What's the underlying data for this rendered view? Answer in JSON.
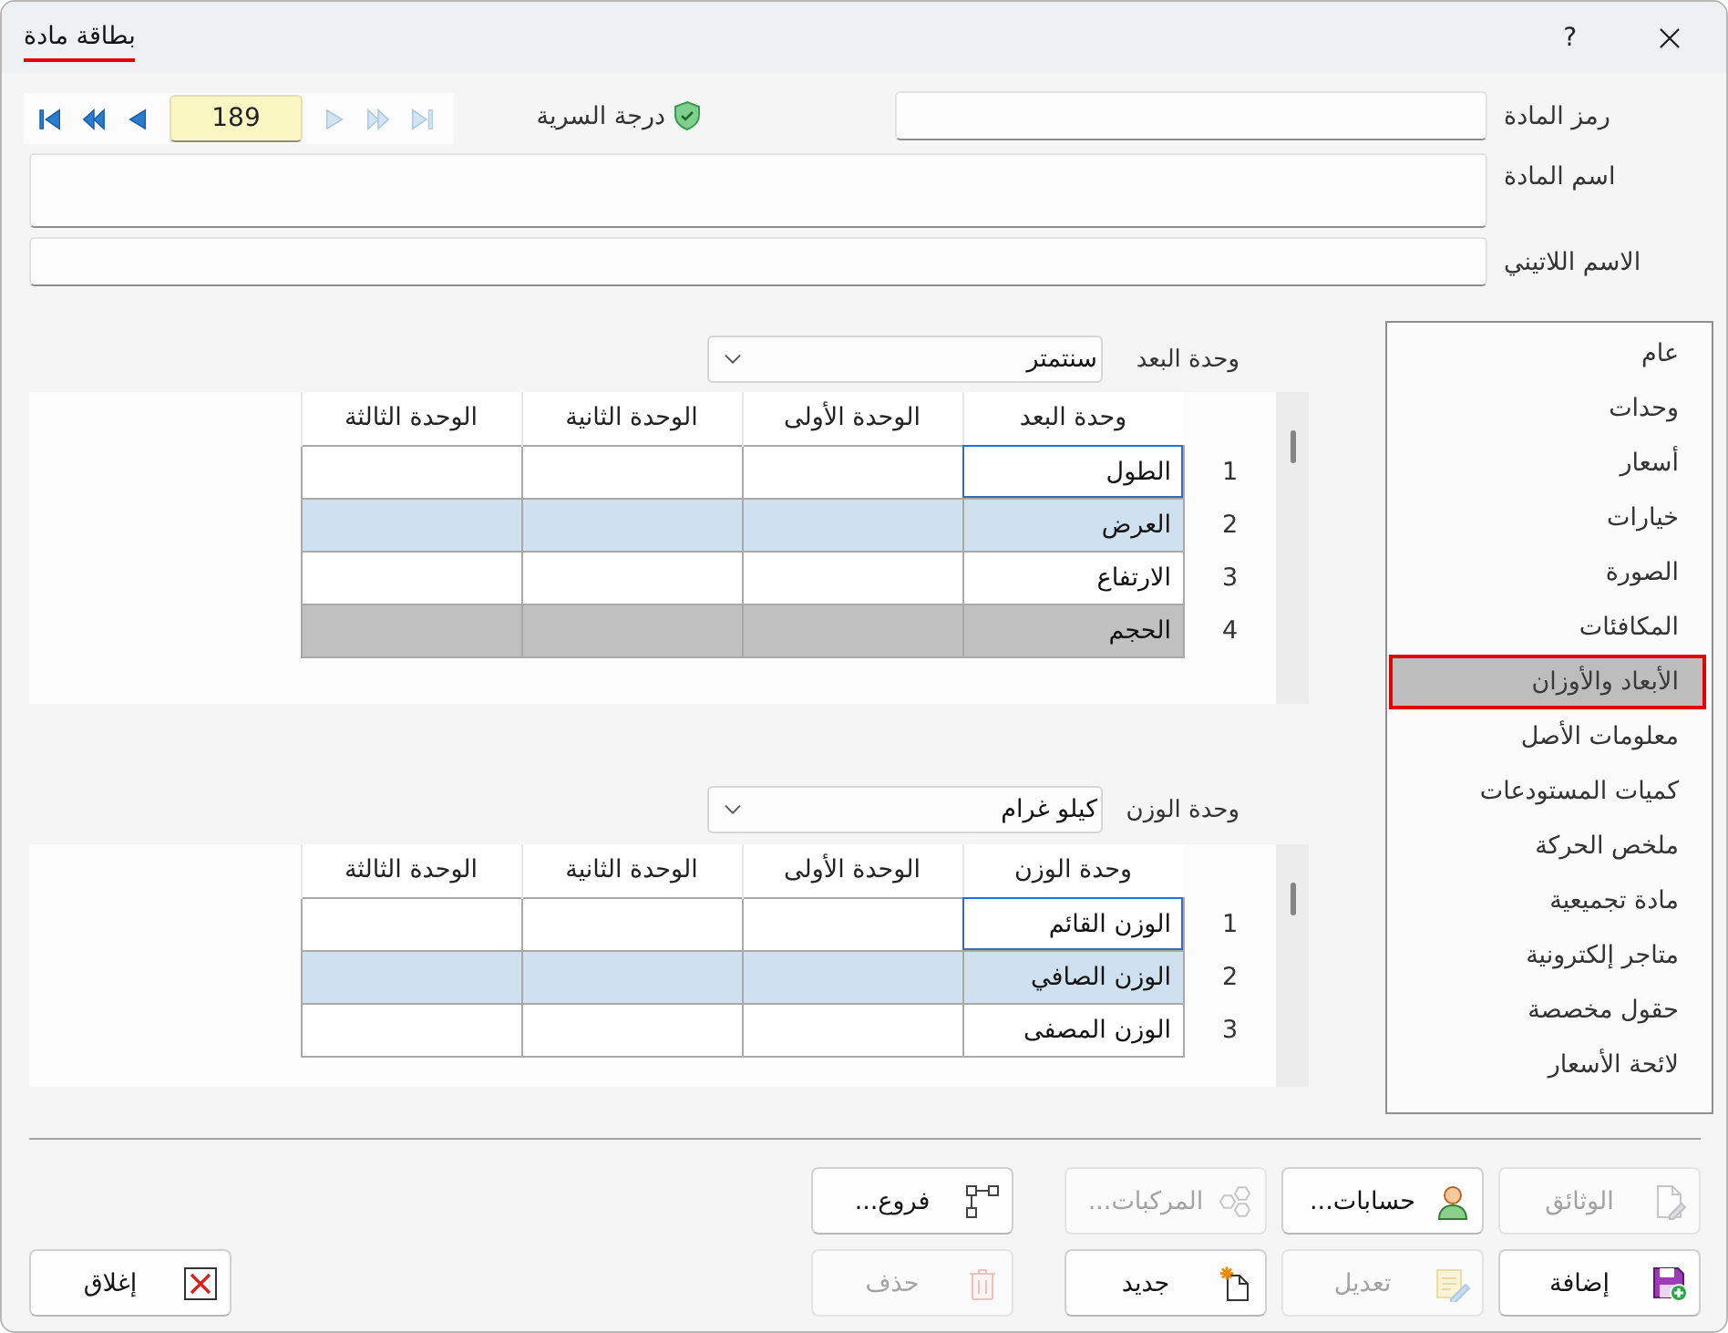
{
  "window": {
    "title": "بطاقة مادة",
    "help": "?"
  },
  "fields": [
    {
      "label": "رمز المادة",
      "kind": "single"
    },
    {
      "label": "اسم المادة",
      "kind": "tall"
    },
    {
      "label": "الاسم اللاتيني",
      "kind": "single"
    }
  ],
  "security": {
    "label": "درجة السرية"
  },
  "record_navigator": {
    "back_buttons": [
      {
        "kind": "first",
        "disabled": false
      },
      {
        "kind": "page_back",
        "disabled": false
      },
      {
        "kind": "back",
        "disabled": false
      }
    ],
    "record_number": "189",
    "forward_buttons": [
      {
        "kind": "forward",
        "disabled": true
      },
      {
        "kind": "page_forward",
        "disabled": true
      },
      {
        "kind": "last",
        "disabled": true
      }
    ]
  },
  "sidebar": {
    "items": [
      {
        "label": "عام",
        "selected": false
      },
      {
        "label": "وحدات",
        "selected": false
      },
      {
        "label": "أسعار",
        "selected": false
      },
      {
        "label": "خيارات",
        "selected": false
      },
      {
        "label": "الصورة",
        "selected": false
      },
      {
        "label": "المكافئات",
        "selected": false
      },
      {
        "label": "الأبعاد والأوزان",
        "selected": true
      },
      {
        "label": "معلومات الأصل",
        "selected": false
      },
      {
        "label": "كميات المستودعات",
        "selected": false
      },
      {
        "label": "ملخص الحركة",
        "selected": false
      },
      {
        "label": "مادة تجميعية",
        "selected": false
      },
      {
        "label": "متاجر إلكترونية",
        "selected": false
      },
      {
        "label": "حقول مخصصة",
        "selected": false
      },
      {
        "label": "لائحة الأسعار",
        "selected": false
      }
    ]
  },
  "unit_grids": [
    {
      "unit_label": "وحدة البعد",
      "unit_value": "سنتمتر",
      "columns": [
        "وحدة البعد",
        "الوحدة الأولى",
        "الوحدة الثانية",
        "الوحدة الثالثة"
      ],
      "rows": [
        {
          "number": "1",
          "name": "الطول",
          "selected": false,
          "focused": true,
          "read_only": false
        },
        {
          "number": "2",
          "name": "العرض",
          "selected": true,
          "focused": false,
          "read_only": false
        },
        {
          "number": "3",
          "name": "الارتفاع",
          "selected": false,
          "focused": false,
          "read_only": false
        },
        {
          "number": "4",
          "name": "الحجم",
          "selected": false,
          "focused": false,
          "read_only": true
        }
      ]
    },
    {
      "unit_label": "وحدة الوزن",
      "unit_value": "كيلو غرام",
      "columns": [
        "وحدة الوزن",
        "الوحدة الأولى",
        "الوحدة الثانية",
        "الوحدة الثالثة"
      ],
      "rows": [
        {
          "number": "1",
          "name": "الوزن القائم",
          "selected": false,
          "focused": true,
          "read_only": false
        },
        {
          "number": "2",
          "name": "الوزن الصافي",
          "selected": true,
          "focused": false,
          "read_only": false
        },
        {
          "number": "3",
          "name": "الوزن المصفى",
          "selected": false,
          "focused": false,
          "read_only": false
        }
      ]
    }
  ],
  "footer": {
    "button_rows": [
      {
        "buttons": [
          {
            "label": "الوثائق",
            "kind": "documents",
            "disabled": true
          },
          {
            "label": "حسابات...",
            "kind": "accounts",
            "disabled": false
          },
          {
            "label": "المركبات...",
            "kind": "components",
            "disabled": true
          },
          {
            "label": "فروع...",
            "kind": "branches",
            "disabled": false
          }
        ]
      },
      {
        "buttons": [
          {
            "label": "إضافة",
            "kind": "add",
            "disabled": false
          },
          {
            "label": "تعديل",
            "kind": "edit",
            "disabled": true
          },
          {
            "label": "جديد",
            "kind": "new",
            "disabled": false
          },
          {
            "label": "حذف",
            "kind": "delete",
            "disabled": true
          }
        ]
      }
    ],
    "close_button": {
      "label": "إغلاق",
      "kind": "close",
      "disabled": false
    }
  }
}
